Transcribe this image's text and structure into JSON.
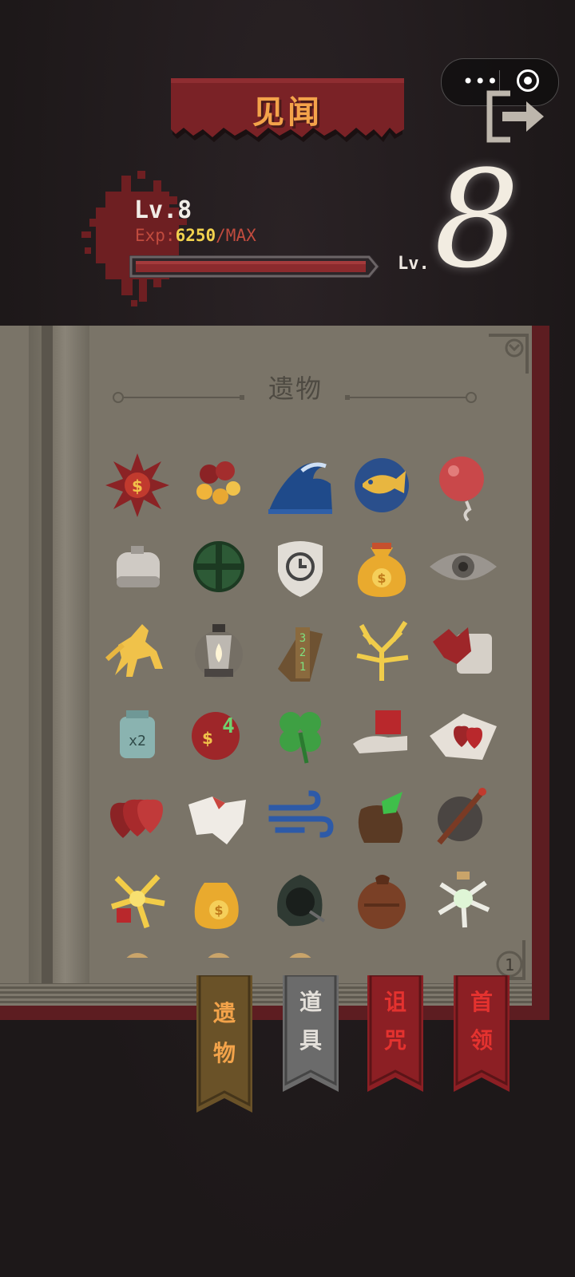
{
  "title": "见闻",
  "level": {
    "label": "Lv.8",
    "exp_prefix": "Exp:",
    "exp_current": "6250",
    "exp_max": "/MAX",
    "bar_label": "Lv.",
    "big_number": "8",
    "progress": 1.0
  },
  "section_title": "遗物",
  "page_number": "1",
  "tabs": [
    {
      "line1": "遗",
      "line2": "物",
      "active": true
    },
    {
      "line1": "道",
      "line2": "具",
      "active": false
    },
    {
      "line1": "诅",
      "line2": "咒",
      "active": false
    },
    {
      "line1": "首",
      "line2": "领",
      "active": false
    }
  ],
  "relics": [
    "red-sun-coin-icon",
    "red-berries-coins-icon",
    "blue-wave-icon",
    "blue-fish-on-coin-icon",
    "red-balloon-icon",
    "grey-coin-purse-icon",
    "green-shield-cross-icon",
    "clock-shield-icon",
    "gold-money-bag-icon",
    "grey-eye-icon",
    "golden-horse-icon",
    "oil-lantern-icon",
    "ruler-321-icon",
    "golden-coral-icon",
    "red-hand-card-icon",
    "x2-jar-icon",
    "coin-and-four-icon",
    "four-leaf-clover-icon",
    "hand-red-cube-icon",
    "heart-pillow-icon",
    "red-heart-stack-icon",
    "white-cloth-icon",
    "blue-wind-icon",
    "green-gem-pouch-icon",
    "grey-bomb-stick-icon",
    "golden-explosion-icon",
    "gold-coin-sacks-icon",
    "dark-hood-icon",
    "leather-sack-icon",
    "white-sparkle-bottle-icon"
  ],
  "colors": {
    "banner": "#7a2226",
    "title_text": "#f3a34a",
    "exp_label": "#c14b3e",
    "exp_value": "#f2d24e",
    "page": "#7a7468",
    "tab_active": "#6a5228",
    "tab_grey": "#6b6b6b",
    "tab_red": "#8c1f24"
  }
}
